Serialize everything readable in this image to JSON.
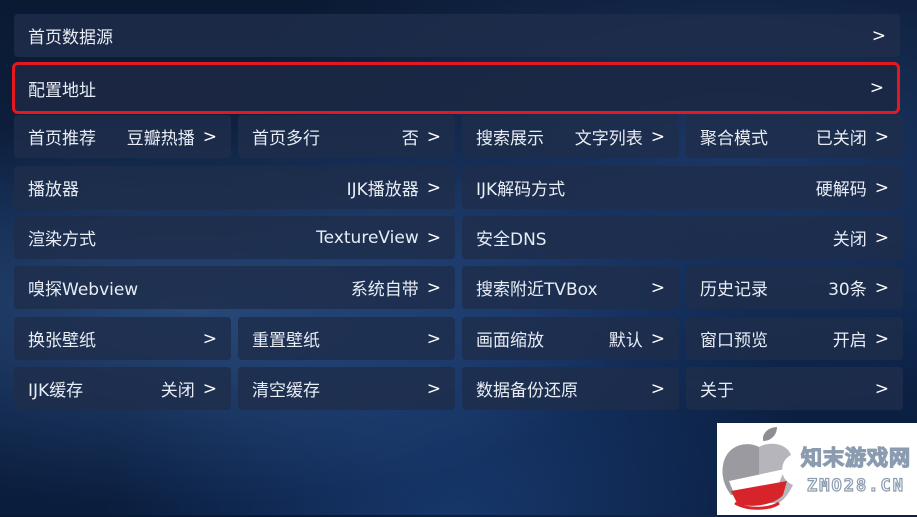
{
  "rows": [
    {
      "label": "首页数据源",
      "value": "",
      "arrow": ">"
    },
    {
      "label": "配置地址",
      "value": "",
      "arrow": ">"
    },
    {
      "label": "首页推荐",
      "value": "豆瓣热播",
      "arrow": ">"
    },
    {
      "label": "首页多行",
      "value": "否",
      "arrow": ">"
    },
    {
      "label": "搜索展示",
      "value": "文字列表",
      "arrow": ">"
    },
    {
      "label": "聚合模式",
      "value": "已关闭",
      "arrow": ">"
    },
    {
      "label": "播放器",
      "value": "IJK播放器",
      "arrow": ">"
    },
    {
      "label": "IJK解码方式",
      "value": "硬解码",
      "arrow": ">"
    },
    {
      "label": "渲染方式",
      "value": "TextureView",
      "arrow": ">"
    },
    {
      "label": "安全DNS",
      "value": "关闭",
      "arrow": ">"
    },
    {
      "label": "嗅探Webview",
      "value": "系统自带",
      "arrow": ">"
    },
    {
      "label": "搜索附近TVBox",
      "value": "",
      "arrow": ">"
    },
    {
      "label": "历史记录",
      "value": "30条",
      "arrow": ">"
    },
    {
      "label": "换张壁纸",
      "value": "",
      "arrow": ">"
    },
    {
      "label": "重置壁纸",
      "value": "",
      "arrow": ">"
    },
    {
      "label": "画面缩放",
      "value": "默认",
      "arrow": ">"
    },
    {
      "label": "窗口预览",
      "value": "开启",
      "arrow": ">"
    },
    {
      "label": "IJK缓存",
      "value": "关闭",
      "arrow": ">"
    },
    {
      "label": "清空缓存",
      "value": "",
      "arrow": ">"
    },
    {
      "label": "数据备份还原",
      "value": "",
      "arrow": ">"
    },
    {
      "label": "关于",
      "value": "",
      "arrow": ">"
    }
  ],
  "watermark": {
    "cn": "知末游戏网",
    "en": "ZMO28.CN",
    "logo": "apple-logo-icon"
  },
  "colors": {
    "selected_border": "#e5171f",
    "tile_bg": "#1e2d4b"
  }
}
